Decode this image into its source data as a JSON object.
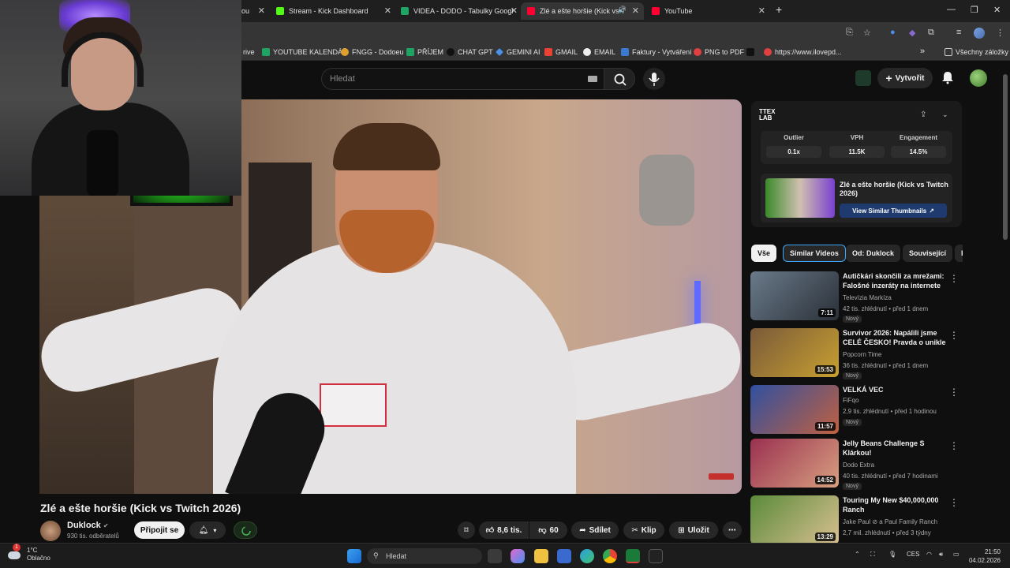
{
  "browser": {
    "tabs": [
      {
        "label": "ou",
        "icon": "drive-icon"
      },
      {
        "label": "Stream - Kick Dashboard",
        "icon": "kick-icon"
      },
      {
        "label": "VIDEA - DODO - Tabulky Googl",
        "icon": "sheets-icon"
      },
      {
        "label": "Zlé a ešte horšie (Kick vs Tw",
        "icon": "youtube-icon",
        "active": true
      },
      {
        "label": "YouTube",
        "icon": "youtube-icon"
      }
    ],
    "bookmarks": [
      {
        "label": "rive"
      },
      {
        "label": "YOUTUBE KALENDÁŘ"
      },
      {
        "label": "FNGG - Dodoeu"
      },
      {
        "label": "PŘÍJEM"
      },
      {
        "label": "CHAT GPT"
      },
      {
        "label": "GEMINI AI"
      },
      {
        "label": "GMAIL"
      },
      {
        "label": "EMAIL"
      },
      {
        "label": "Faktury - Vytváření"
      },
      {
        "label": "PNG to PDF"
      },
      {
        "label": ""
      },
      {
        "label": "https://www.ilovepd..."
      }
    ],
    "all_bookmarks": "Všechny záložky",
    "colors": {
      "accent": "#3ea6ff",
      "brand": "#ff0033"
    }
  },
  "yt": {
    "search_placeholder": "Hledat",
    "create_label": "Vytvořit"
  },
  "video": {
    "title": "Zlé a ešte horšie (Kick vs Twitch 2026)",
    "channel": "Duklock",
    "subscribers": "930 tis. odběratelů",
    "join_label": "Připojit se",
    "likes": "8,6 tis.",
    "dislikes": "60",
    "share_label": "Sdílet",
    "clip_label": "Klip",
    "save_label": "Uložit"
  },
  "extension": {
    "logo": "TTEX LAB",
    "stats": [
      {
        "label": "Outlier",
        "value": "0.1x"
      },
      {
        "label": "VPH",
        "value": "11.5K"
      },
      {
        "label": "Engagement",
        "value": "14.5%"
      }
    ],
    "card_title": "Zlé a ešte horšie (Kick vs Twitch 2026)",
    "card_button": "View Similar Thumbnails"
  },
  "chips": [
    "Vše",
    "Similar Videos",
    "Od: Duklock",
    "Související",
    "I"
  ],
  "recommendations": [
    {
      "title": "Autičkári skončili za mrežami: Falošné inzeráty na internete ...",
      "channel": "Televízia Markíza",
      "meta": "42 tis. zhlédnutí • před 1 dnem",
      "badge": "Nový",
      "duration": "7:11"
    },
    {
      "title": "Survivor 2026: Napálili jsme CELÉ ČESKO! Pravda o unikle ...",
      "channel": "Popcorn Time",
      "meta": "36 tis. zhlédnutí • před 1 dnem",
      "badge": "Nový",
      "duration": "15:53"
    },
    {
      "title": "VELKÁ VEC",
      "channel": "FiFqo",
      "meta": "2,9 tis. zhlédnutí • před 1 hodinou",
      "badge": "Nový",
      "duration": "11:57"
    },
    {
      "title": "Jelly Beans Challenge S Klárkou!",
      "channel": "Dodo Extra",
      "meta": "40 tis. zhlédnutí • před 7 hodinami",
      "badge": "Nový",
      "duration": "14:52"
    },
    {
      "title": "Touring My New $40,000,000 Ranch",
      "channel": "Jake Paul ⊘ a Paul Family Ranch",
      "meta": "2,7 mil. zhlédnutí • před 3 týdny",
      "badge": "",
      "duration": "13:29"
    }
  ],
  "taskbar": {
    "weather_temp": "1°C",
    "weather_desc": "Oblačno",
    "notif_count": "1",
    "search_label": "Hledat",
    "lang": "CES",
    "time": "21:50",
    "date": "04.02.2026"
  }
}
